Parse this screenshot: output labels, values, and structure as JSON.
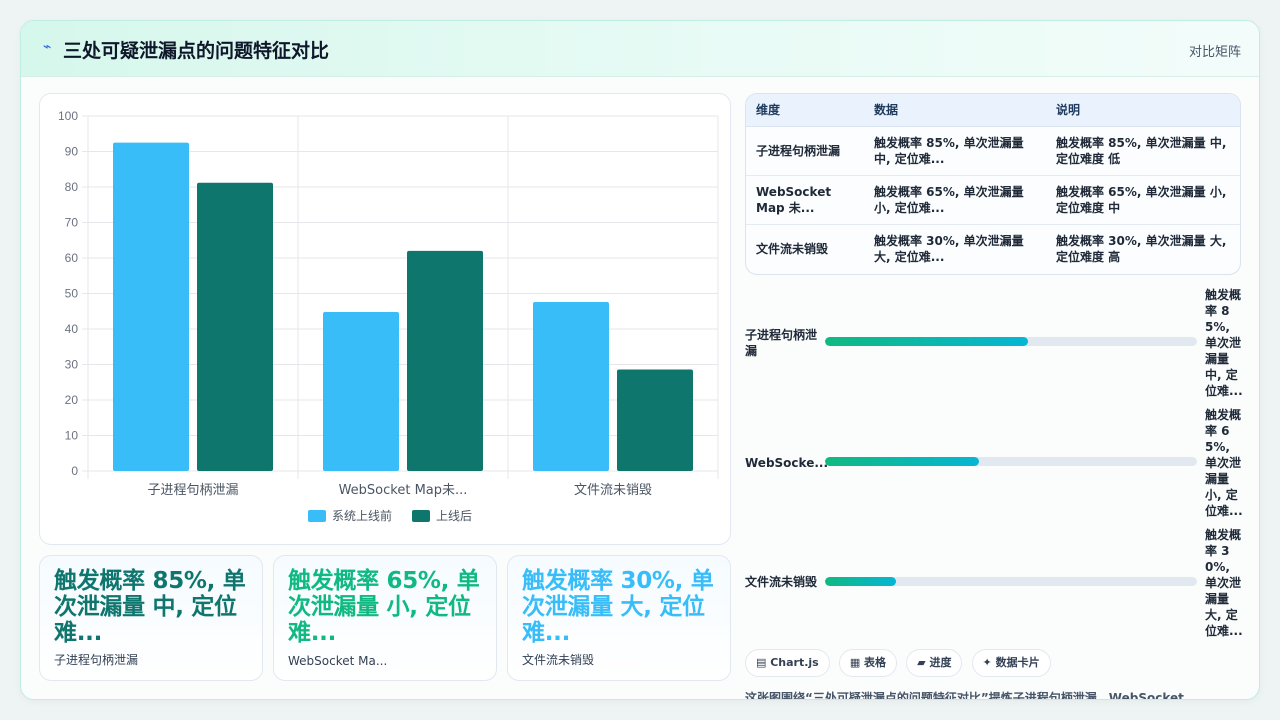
{
  "header": {
    "title": "三处可疑泄漏点的问题特征对比",
    "tag": "对比矩阵"
  },
  "chart_data": {
    "type": "bar",
    "categories": [
      "子进程句柄泄漏",
      "WebSocket Map未...",
      "文件流未销毁"
    ],
    "series": [
      {
        "name": "系统上线前",
        "values": [
          92.5,
          44.8,
          47.6
        ],
        "color": "#38bdf8"
      },
      {
        "name": "上线后",
        "values": [
          81.2,
          62.0,
          28.6
        ],
        "color": "#0f766e"
      }
    ],
    "yticks": [
      "0",
      "10",
      "20",
      "30",
      "40",
      "50",
      "60",
      "70",
      "80",
      "90",
      "100"
    ],
    "ylim": [
      0,
      100
    ],
    "legend": "bottom"
  },
  "stats": [
    {
      "value": "触发概率 85%, 单次泄漏量 中, 定位难...",
      "label": "子进程句柄泄漏",
      "color": "#0f766e"
    },
    {
      "value": "触发概率 65%, 单次泄漏量 小, 定位难...",
      "label": "WebSocket Ma...",
      "color": "#10b981"
    },
    {
      "value": "触发概率 30%, 单次泄漏量 大, 定位难...",
      "label": "文件流未销毁",
      "color": "#38bdf8"
    }
  ],
  "table": {
    "headers": [
      "维度",
      "数据",
      "说明"
    ],
    "rows": [
      [
        "子进程句柄泄漏",
        "触发概率 85%, 单次泄漏量 中, 定位难...",
        "触发概率 85%, 单次泄漏量 中, 定位难度 低"
      ],
      [
        "WebSocket Map 未...",
        "触发概率 65%, 单次泄漏量 小, 定位难...",
        "触发概率 65%, 单次泄漏量 小, 定位难度 中"
      ],
      [
        "文件流未销毁",
        "触发概率 30%, 单次泄漏量 大, 定位难...",
        "触发概率 30%, 单次泄漏量 大, 定位难度 高"
      ]
    ]
  },
  "progress": [
    {
      "label": "子进程句柄泄漏",
      "value": "触发概率 85%, 单次泄漏量 中, 定位难...",
      "fraction": 0.545
    },
    {
      "label": "WebSocke...",
      "value": "触发概率 65%, 单次泄漏量 小, 定位难...",
      "fraction": 0.415
    },
    {
      "label": "文件流未销毁",
      "value": "触发概率 30%, 单次泄漏量 大, 定位难...",
      "fraction": 0.19
    }
  ],
  "chips": [
    "▤ Chart.js",
    "▦ 表格",
    "▰ 进度",
    "✦ 数据卡片"
  ],
  "description": "这张图围绕“三处可疑泄漏点的问题特征对比”提炼子进程句柄泄漏、WebSocket"
}
